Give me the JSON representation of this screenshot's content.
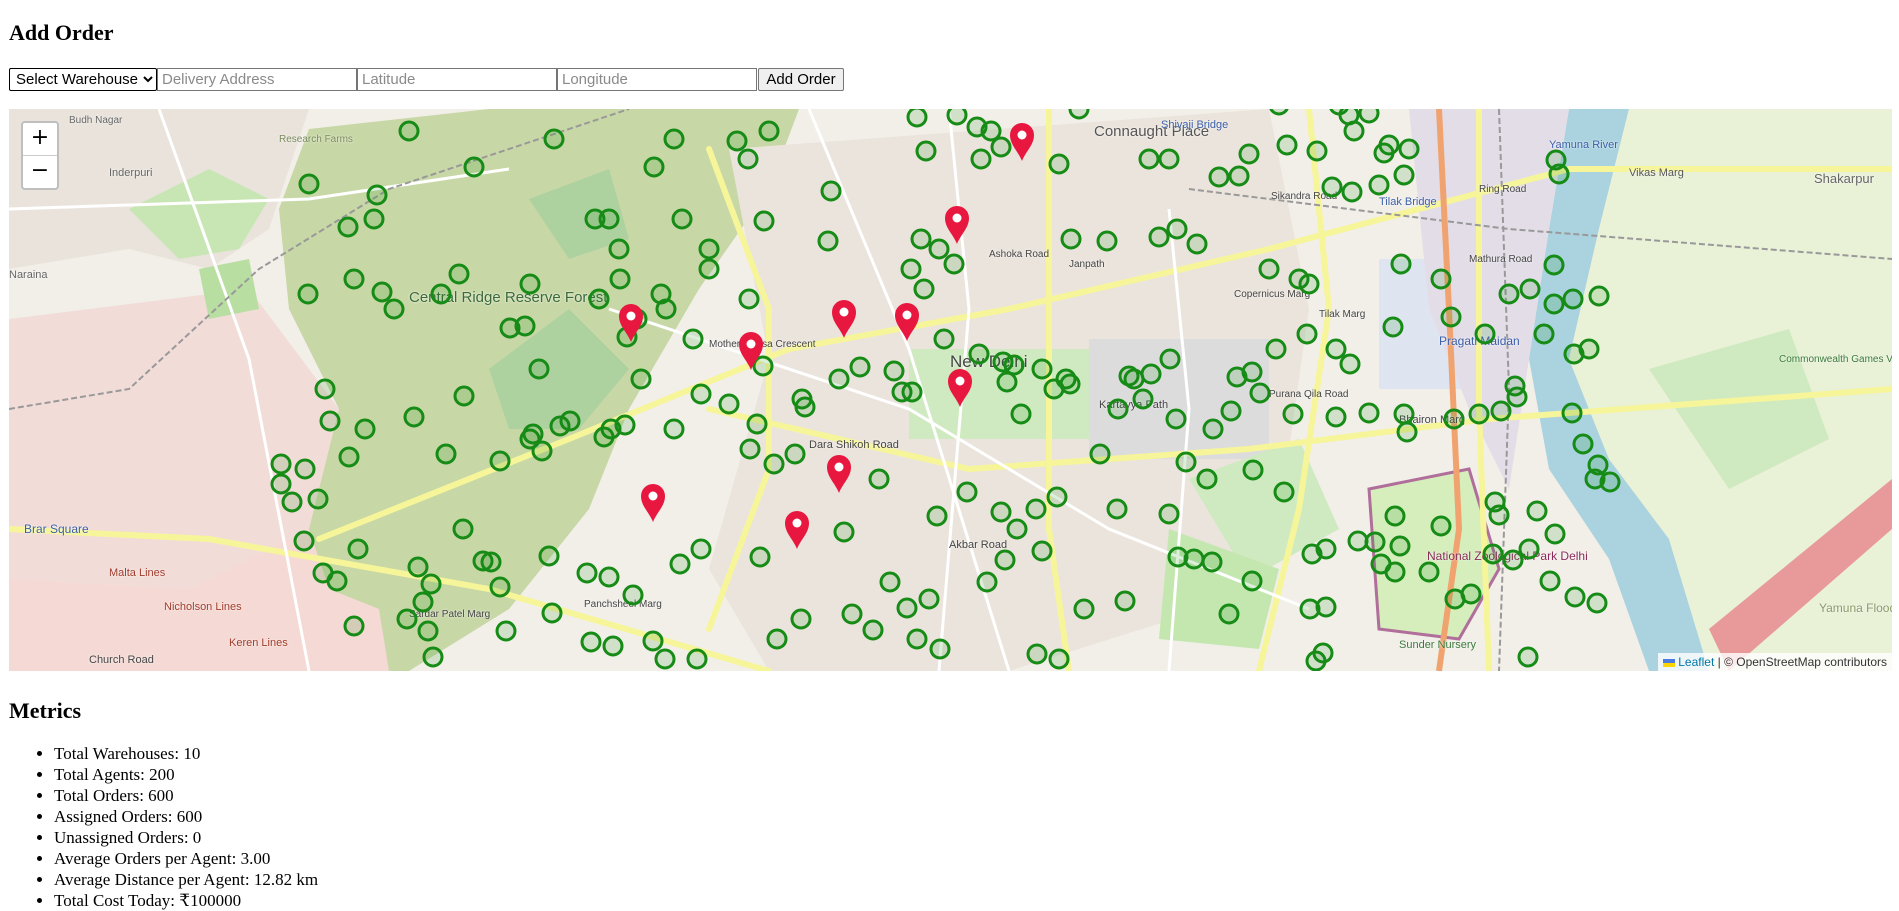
{
  "add_order": {
    "title": "Add Order",
    "warehouse_select": "Select Warehouse",
    "address_placeholder": "Delivery Address",
    "latitude_placeholder": "Latitude",
    "longitude_placeholder": "Longitude",
    "add_button": "Add Order"
  },
  "map": {
    "zoom_in": "+",
    "zoom_out": "−",
    "attribution_link": "Leaflet",
    "attribution_rest": " | © OpenStreetMap contributors",
    "labels": [
      "Connaught Place",
      "New Delhi",
      "Central Ridge Reserve Forest",
      "Brar Square",
      "Pragati Maidan",
      "National Zoological Park Delhi",
      "Tilak Bridge",
      "Yamuna River",
      "Shakarpur",
      "Malta Lines",
      "Nicholson Lines",
      "Keren Lines",
      "Church Road",
      "Sunder Nursery",
      "Yamuna Floodplain",
      "Commonwealth Games Village Sports Complex",
      "Vikas Marg",
      "Research Farms",
      "Inderpuri",
      "Naraina",
      "Budh Nagar",
      "Shivaji Bridge",
      "Dara Shikoh Road",
      "Akbar Road",
      "Kartavya Path",
      "Bhairon Marg",
      "Mathura Road",
      "Janpath",
      "Sardar Patel Marg",
      "Mother Teresa Crescent",
      "Panchsheel Marg",
      "Sikandra Road",
      "Ashoka Road",
      "Tilak Marg",
      "Copernicus Marg",
      "Purana Qila Road",
      "Ring Road"
    ],
    "warehouse_color": "#e8173f",
    "agent_color": "#168b16"
  },
  "metrics": {
    "title": "Metrics",
    "items": [
      "Total Warehouses: 10",
      "Total Agents: 200",
      "Total Orders: 600",
      "Assigned Orders: 600",
      "Unassigned Orders: 0",
      "Average Orders per Agent: 3.00",
      "Average Distance per Agent: 12.82 km",
      "Total Cost Today: ₹100000"
    ]
  }
}
